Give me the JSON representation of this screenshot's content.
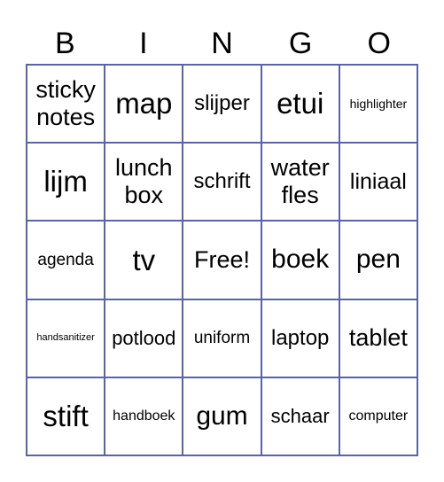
{
  "header": [
    "B",
    "I",
    "N",
    "G",
    "O"
  ],
  "colors": {
    "grid_border": "#5a63a8",
    "text": "#000000",
    "background": "#ffffff"
  },
  "cells": [
    [
      "sticky notes",
      "map",
      "slijper",
      "etui",
      "highlighter"
    ],
    [
      "lijm",
      "lunch box",
      "schrift",
      "water fles",
      "liniaal"
    ],
    [
      "agenda",
      "tv",
      "Free!",
      "boek",
      "pen"
    ],
    [
      "handsanitizer",
      "potlood",
      "uniform",
      "laptop",
      "tablet"
    ],
    [
      "stift",
      "handboek",
      "gum",
      "schaar",
      "computer"
    ]
  ]
}
